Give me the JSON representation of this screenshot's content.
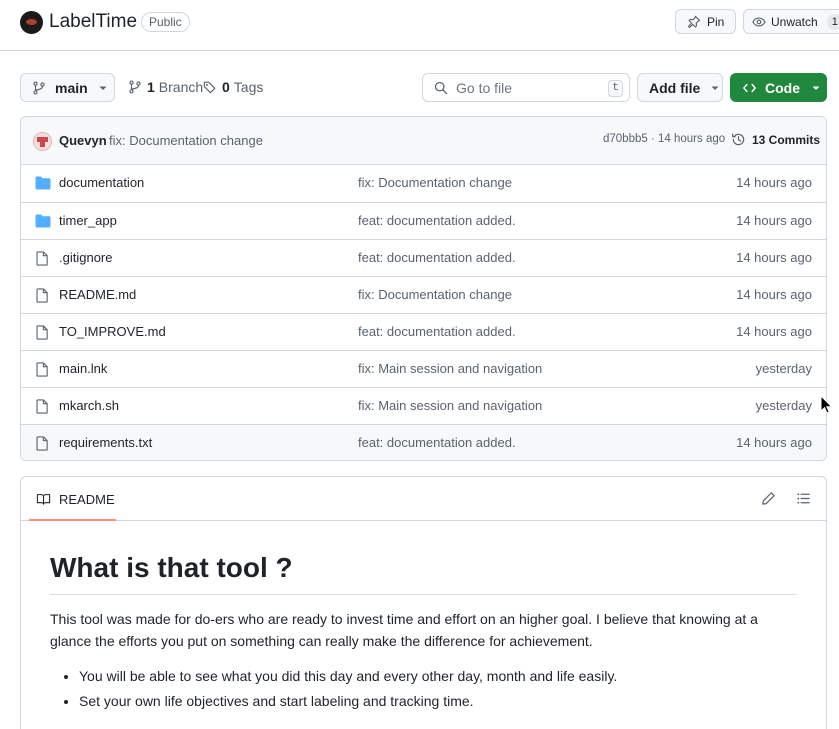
{
  "repo": {
    "name": "LabelTime",
    "visibility": "Public",
    "pin_label": "Pin",
    "watch_label": "Unwatch",
    "watch_count": "1"
  },
  "toolbar": {
    "branch": "main",
    "branches_count": "1",
    "branches_label": "Branch",
    "tags_count": "0",
    "tags_label": "Tags",
    "goto_placeholder": "Go to file",
    "goto_shortcut": "t",
    "add_file_label": "Add file",
    "code_label": "Code"
  },
  "latest_commit": {
    "author": "Quevyn",
    "message": "fix: Documentation change",
    "hash_time": "d70bbb5 · 14 hours ago",
    "commits_label": "13 Commits"
  },
  "files": [
    {
      "type": "folder",
      "name": "documentation",
      "message": "fix: Documentation change",
      "time": "14 hours ago"
    },
    {
      "type": "folder",
      "name": "timer_app",
      "message": "feat: documentation added.",
      "time": "14 hours ago"
    },
    {
      "type": "file",
      "name": ".gitignore",
      "message": "feat: documentation added.",
      "time": "14 hours ago"
    },
    {
      "type": "file",
      "name": "README.md",
      "message": "fix: Documentation change",
      "time": "14 hours ago"
    },
    {
      "type": "file",
      "name": "TO_IMPROVE.md",
      "message": "feat: documentation added.",
      "time": "14 hours ago"
    },
    {
      "type": "file",
      "name": "main.lnk",
      "message": "fix: Main session and navigation",
      "time": "yesterday"
    },
    {
      "type": "file",
      "name": "mkarch.sh",
      "message": "fix: Main session and navigation",
      "time": "yesterday"
    },
    {
      "type": "file",
      "name": "requirements.txt",
      "message": "feat: documentation added.",
      "time": "14 hours ago"
    }
  ],
  "readme": {
    "tab_label": "README",
    "heading": "What is that tool ?",
    "paragraph": "This tool was made for do-ers who are ready to invest time and effort on an higher goal. I believe that knowing at a glance the efforts you put on something can really make the difference for achievement.",
    "bullets": [
      "You will be able to see what you did this day and every other day, month and life easily.",
      "Set your own life objectives and start labeling and tracking time."
    ]
  },
  "colors": {
    "primary_green": "#1f883d",
    "folder_blue": "#54aeff",
    "border": "#d0d7de",
    "muted_text": "#59636e",
    "tab_underline": "#fd8c73"
  }
}
